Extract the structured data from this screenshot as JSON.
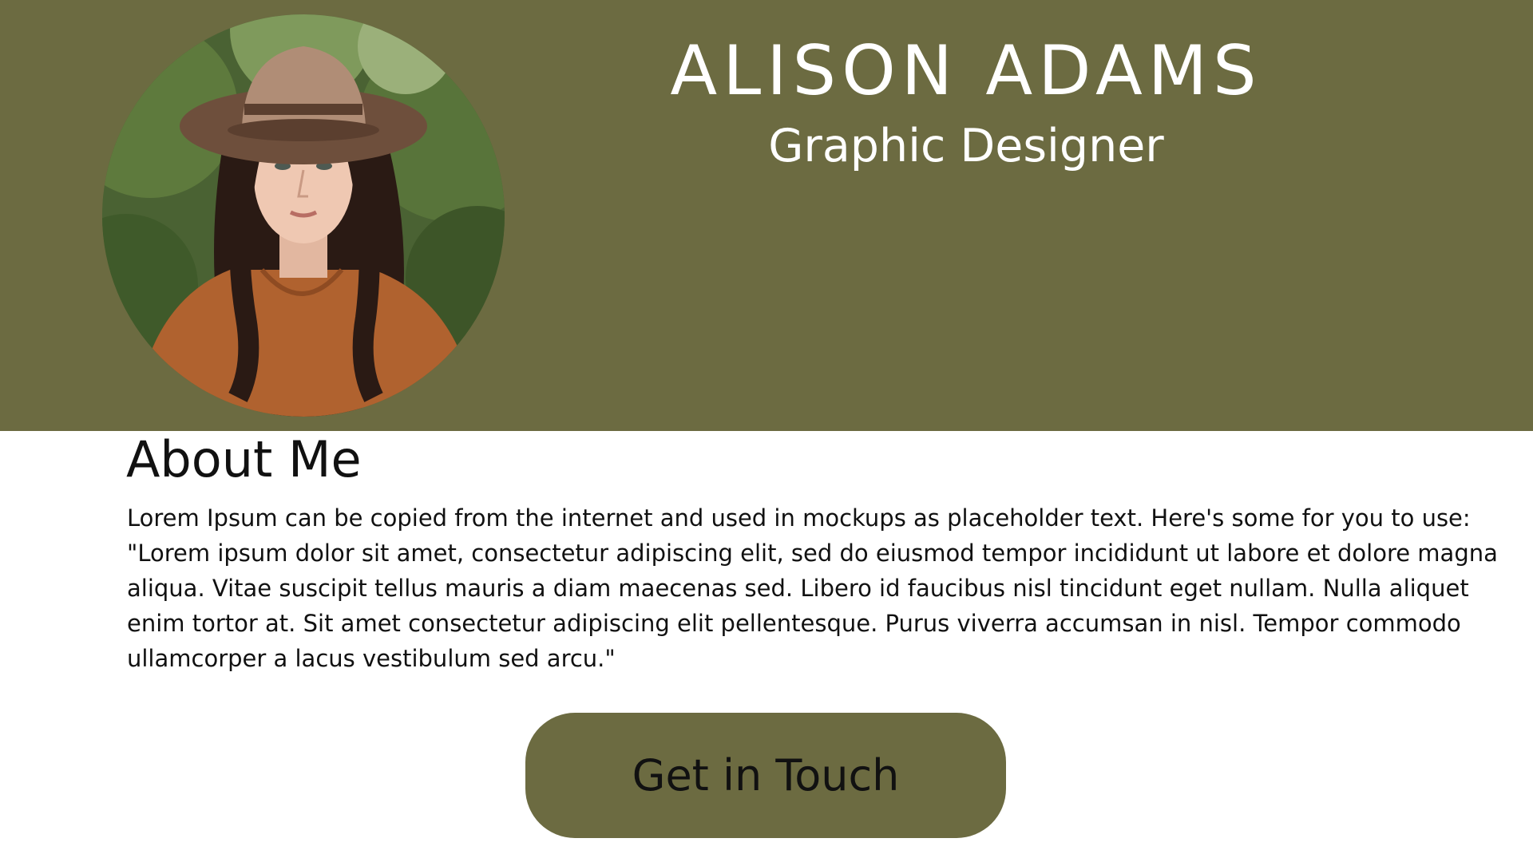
{
  "profile": {
    "name": "ALISON ADAMS",
    "title": "Graphic Designer"
  },
  "about": {
    "heading": "About Me",
    "body": "Lorem Ipsum can be copied from the internet and used in mockups as placeholder text. Here's some for you to use: \"Lorem ipsum dolor sit amet, consectetur adipiscing elit, sed do eiusmod tempor incididunt ut labore et dolore magna aliqua. Vitae suscipit tellus mauris a diam maecenas sed. Libero id faucibus nisl tincidunt eget nullam. Nulla aliquet enim tortor at. Sit amet consectetur adipiscing elit pellentesque. Purus viverra accumsan in nisl. Tempor commodo ullamcorper a lacus vestibulum sed arcu.\""
  },
  "cta": {
    "label": "Get in Touch"
  },
  "colors": {
    "accent": "#6c6b41",
    "header_text": "#ffffff",
    "body_text": "#111111",
    "background": "#ffffff"
  }
}
